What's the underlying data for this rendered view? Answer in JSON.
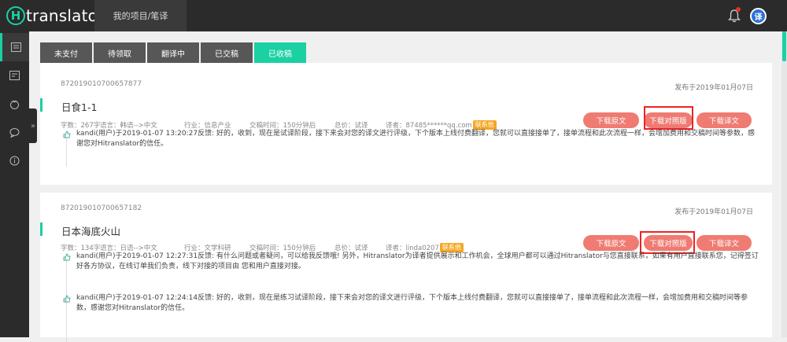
{
  "header": {
    "logo_letter": "H",
    "logo_text": "translator",
    "tab_label": "我的项目/笔译",
    "avatar_letter": "译"
  },
  "sidebar": {
    "icons": [
      "project-icon",
      "order-icon",
      "wallet-icon",
      "message-icon",
      "info-icon"
    ],
    "collapse_glyph": "»"
  },
  "tabs": [
    {
      "label": "未支付",
      "active": false
    },
    {
      "label": "待领取",
      "active": false
    },
    {
      "label": "翻译中",
      "active": false
    },
    {
      "label": "已交稿",
      "active": false
    },
    {
      "label": "已收稿",
      "active": true
    }
  ],
  "orders": [
    {
      "order_no": "872019010700657877",
      "published": "发布于2019年01月07日",
      "title": "日食1-1",
      "meta": {
        "words": "字数：267字",
        "lang": "语言：韩语-->中文",
        "industry": "行业：信息产业",
        "deadline": "交稿时间：150分钟后",
        "price": "总价：试译",
        "translator": "译者：87485******qq.com",
        "contact": "联系他"
      },
      "buttons": [
        "下载原文",
        "下载对照版",
        "下载译文"
      ],
      "feedback": [
        "kandi(用户)于2019-01-07 13:20:27反馈: 好的，收到，现在是试译阶段，接下来会对您的译文进行评级，下个版本上线付费翻译，您就可以直接接单了，接单流程和此次流程一样，会增加费用和交稿时间等参数，感谢您对Hitranslator的信任。"
      ]
    },
    {
      "order_no": "872019010700657182",
      "published": "发布于2019年01月07日",
      "title": "日本海底火山",
      "meta": {
        "words": "字数：134字",
        "lang": "语言：日语-->中文",
        "industry": "行业：文学科研",
        "deadline": "交稿时间：150分钟后",
        "price": "总价：试译",
        "translator": "译者：linda0207",
        "contact": "联系他"
      },
      "buttons": [
        "下载原文",
        "下载对照版",
        "下载译文"
      ],
      "feedback": [
        "kandi(用户)于2019-01-07 12:27:31反馈: 有什么问题或者疑问，可以给我反馈哦! 另外，Hitranslator为译者提供展示和工作机会，全球用户都可以通过Hitranslator与您直接联系，如果有用户直接联系您，记得签订好各方协议，在线订单我们负责，线下对接的项目由 您和用户直接对接。",
        "kandi(用户)于2019-01-07 12:24:14反馈: 好的，收到，现在是练习试译阶段，接下来会对您的译文进行评级，下个版本上线付费翻译，您就可以直接接单了，接单流程和此次流程一样，会增加费用和交稿时间等参数，感谢您对Hitranslator的信任。"
      ]
    }
  ],
  "colors": {
    "accent": "#1bd0a3",
    "button": "#ef7b72",
    "badge": "#f5a623",
    "highlight": "#e22222"
  }
}
